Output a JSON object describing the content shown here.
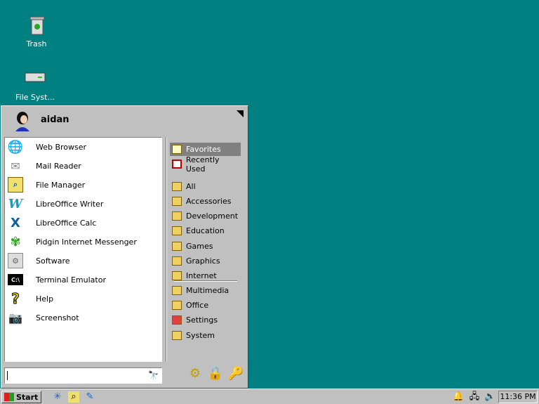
{
  "desktop": {
    "icons": [
      {
        "label": "Trash",
        "icon": "trash-icon"
      },
      {
        "label": "File Syst...",
        "icon": "drive-icon"
      }
    ]
  },
  "menu": {
    "user": "aidan",
    "apps": [
      {
        "label": "Web Browser",
        "icon": "globe-icon"
      },
      {
        "label": "Mail Reader",
        "icon": "envelope-icon"
      },
      {
        "label": "File Manager",
        "icon": "folder-search-icon"
      },
      {
        "label": "LibreOffice Writer",
        "icon": "writer-icon"
      },
      {
        "label": "LibreOffice Calc",
        "icon": "calc-icon"
      },
      {
        "label": "Pidgin Internet Messenger",
        "icon": "pidgin-icon"
      },
      {
        "label": "Software",
        "icon": "software-icon"
      },
      {
        "label": "Terminal Emulator",
        "icon": "terminal-icon"
      },
      {
        "label": "Help",
        "icon": "help-icon"
      },
      {
        "label": "Screenshot",
        "icon": "camera-icon"
      }
    ],
    "favorites": "Favorites",
    "recent": "Recently Used",
    "categories": [
      "All",
      "Accessories",
      "Development",
      "Education",
      "Games",
      "Graphics",
      "Internet",
      "Multimedia",
      "Office",
      "Settings",
      "System"
    ],
    "search": {
      "value": ""
    }
  },
  "taskbar": {
    "start": "Start",
    "clock": "11:36 PM"
  },
  "colors": {
    "desktop": "#008080",
    "panel": "#c0c0c0",
    "selected": "#808080"
  }
}
